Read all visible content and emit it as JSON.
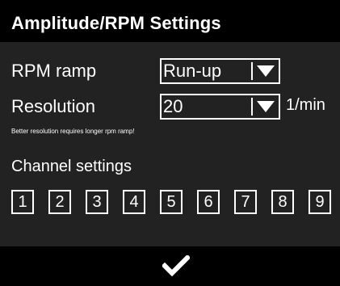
{
  "header": {
    "title": "Amplitude/RPM Settings"
  },
  "rpm_ramp": {
    "label": "RPM ramp",
    "value": "Run-up"
  },
  "resolution": {
    "label": "Resolution",
    "value": "20",
    "unit": "1/min"
  },
  "hint": "Better resolution requires longer rpm ramp!",
  "channels": {
    "label": "Channel settings",
    "items": [
      "1",
      "2",
      "3",
      "4",
      "5",
      "6",
      "7",
      "8",
      "9"
    ]
  },
  "footer": {
    "confirm_icon": "checkmark-icon"
  },
  "colors": {
    "background": "#222222",
    "bar": "#000000",
    "foreground": "#ffffff"
  }
}
